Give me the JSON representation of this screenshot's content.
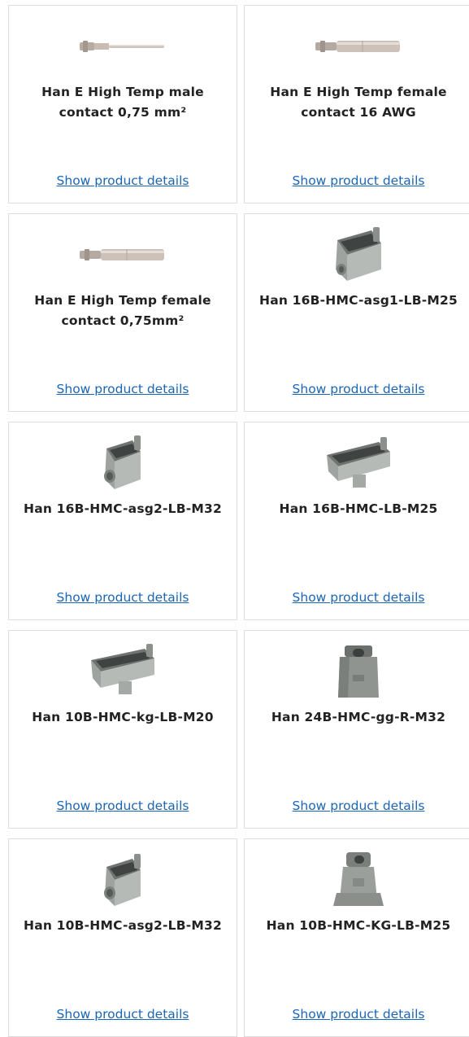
{
  "products": [
    {
      "title": "Han E High Temp male contact 0,75 mm²",
      "link": "Show product details",
      "image": "male-contact-pin-icon"
    },
    {
      "title": "Han E High Temp female contact 16 AWG",
      "link": "Show product details",
      "image": "female-contact-pin-icon"
    },
    {
      "title": "Han E High Temp female contact 0,75mm²",
      "link": "Show product details",
      "image": "female-contact-pin-icon"
    },
    {
      "title": "Han 16B-HMC-asg1-LB-M25",
      "link": "Show product details",
      "image": "hood-housing-icon"
    },
    {
      "title": "Han 16B-HMC-asg2-LB-M32",
      "link": "Show product details",
      "image": "hood-housing-icon"
    },
    {
      "title": "Han 16B-HMC-LB-M25",
      "link": "Show product details",
      "image": "hood-housing-icon"
    },
    {
      "title": "Han 10B-HMC-kg-LB-M20",
      "link": "Show product details",
      "image": "hood-housing-icon"
    },
    {
      "title": "Han 24B-HMC-gg-R-M32",
      "link": "Show product details",
      "image": "hood-housing-icon"
    },
    {
      "title": "Han 10B-HMC-asg2-LB-M32",
      "link": "Show product details",
      "image": "hood-housing-icon"
    },
    {
      "title": "Han 10B-HMC-KG-LB-M25",
      "link": "Show product details",
      "image": "hood-housing-icon"
    }
  ],
  "colors": {
    "link": "#1a66b5",
    "title": "#222222",
    "border": "#dcdcdc"
  }
}
